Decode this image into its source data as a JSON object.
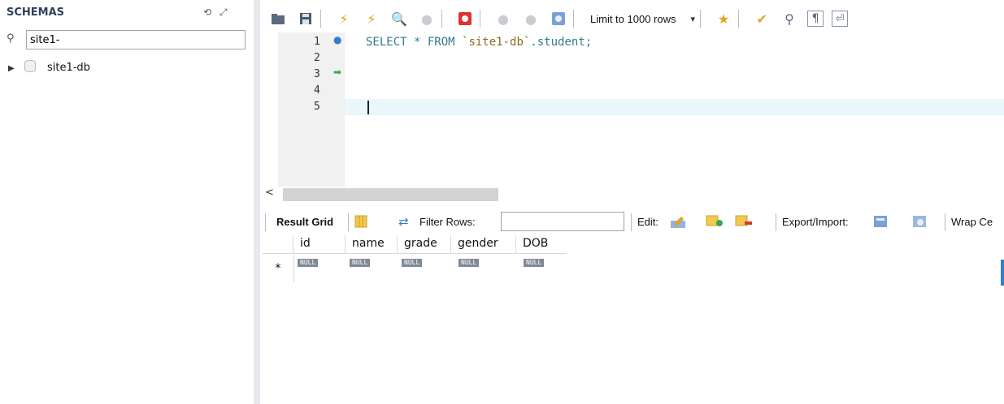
{
  "navigator": {
    "title": "SCHEMAS",
    "search_value": "site1-",
    "tree": [
      {
        "label": "site1-db",
        "icon": "database-icon"
      }
    ]
  },
  "toolbar": {
    "limit_label": "Limit to 1000 rows"
  },
  "editor": {
    "line_numbers": [
      "1",
      "2",
      "3",
      "4",
      "5"
    ],
    "code": {
      "keyword": "SELECT * FROM ",
      "schema": "`site1-db`",
      "rest": ".student;"
    }
  },
  "result_toolbar": {
    "result_grid_label": "Result Grid",
    "filter_rows_label": "Filter Rows:",
    "filter_value": "",
    "edit_label": "Edit:",
    "export_label": "Export/Import:",
    "wrap_label": "Wrap Ce"
  },
  "grid": {
    "columns": [
      "id",
      "name",
      "grade",
      "gender",
      "DOB"
    ],
    "new_row_marker": "*",
    "null_text": "NULL"
  },
  "colors": {
    "accent": "#2f7fd0",
    "current_line": "#eaf7fb",
    "keyword": "#2d7d8c"
  }
}
